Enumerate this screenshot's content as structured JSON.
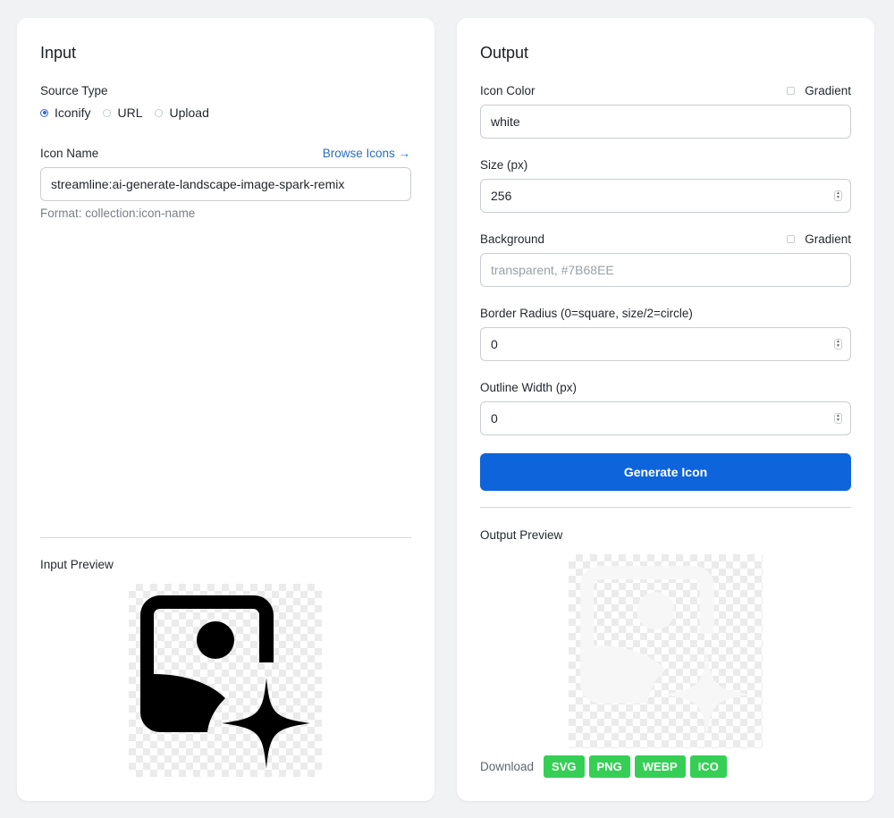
{
  "input": {
    "title": "Input",
    "source_type_label": "Source Type",
    "source_options": [
      {
        "label": "Iconify",
        "checked": true
      },
      {
        "label": "URL",
        "checked": false
      },
      {
        "label": "Upload",
        "checked": false
      }
    ],
    "icon_name_label": "Icon Name",
    "browse_link": "Browse Icons →",
    "icon_name_value": "streamline:ai-generate-landscape-image-spark-remix",
    "format_hint": "Format: collection:icon-name",
    "preview_label": "Input Preview",
    "preview_icon": "ai-generate-landscape-image-spark-icon"
  },
  "output": {
    "title": "Output",
    "icon_color_label": "Icon Color",
    "gradient_label": "Gradient",
    "icon_color_value": "white",
    "size_label": "Size (px)",
    "size_value": "256",
    "background_label": "Background",
    "background_gradient_label": "Gradient",
    "background_placeholder": "transparent, #7B68EE",
    "border_radius_label": "Border Radius (0=square, size/2=circle)",
    "border_radius_value": "0",
    "outline_width_label": "Outline Width (px)",
    "outline_width_value": "0",
    "generate_button": "Generate Icon",
    "preview_label": "Output Preview",
    "download_label": "Download",
    "download_formats": [
      "SVG",
      "PNG",
      "WEBP",
      "ICO"
    ]
  },
  "colors": {
    "accent": "#0e64db",
    "link": "#2a6ebb",
    "download": "#35cf55",
    "page_bg": "#f1f2f4"
  }
}
